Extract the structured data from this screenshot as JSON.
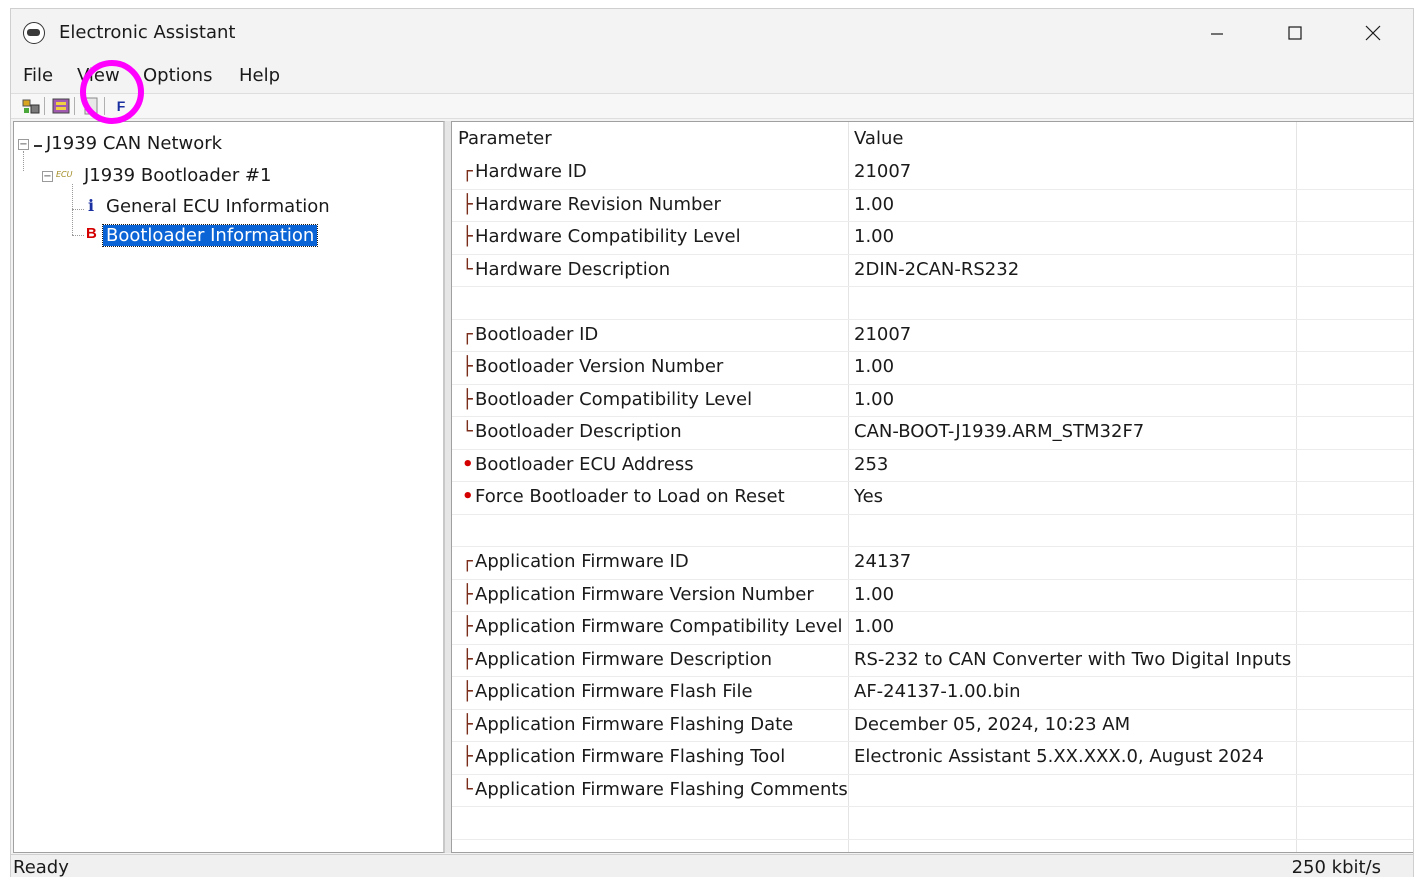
{
  "window": {
    "title": "Electronic Assistant",
    "app_icon": "ea-logo-icon",
    "controls": {
      "minimize": "−",
      "maximize": "☐",
      "close": "✕"
    }
  },
  "menu": [
    "File",
    "View",
    "Options",
    "Help"
  ],
  "toolbar": {
    "buttons": [
      {
        "name": "connect-icon",
        "glyph": "▤"
      },
      {
        "name": "bootloader-icon",
        "glyph": "▦"
      },
      {
        "name": "document-icon",
        "glyph": "▯"
      },
      {
        "name": "flash-icon",
        "glyph": "F"
      }
    ],
    "highlight_color": "#ff00ff"
  },
  "tree": {
    "root": {
      "label": "J1939 CAN Network",
      "expander": "−"
    },
    "ecu": {
      "label": "J1939 Bootloader #1",
      "badge": "ECU",
      "expander": "−"
    },
    "children": [
      {
        "label": "General ECU Information",
        "icon": "i",
        "icon_color": "#1a2fa0"
      },
      {
        "label": "Bootloader Information",
        "icon": "B",
        "icon_color": "#d40000",
        "selected": true
      }
    ],
    "selection_color": "#0a64d6"
  },
  "grid": {
    "headers": {
      "parameter": "Parameter",
      "value": "Value"
    },
    "rows": [
      {
        "marker": "┌",
        "parameter": "Hardware ID",
        "value": "21007"
      },
      {
        "marker": "├",
        "parameter": "Hardware Revision Number",
        "value": "1.00"
      },
      {
        "marker": "├",
        "parameter": "Hardware Compatibility Level",
        "value": "1.00"
      },
      {
        "marker": "└",
        "parameter": "Hardware Description",
        "value": "2DIN-2CAN-RS232"
      },
      {
        "marker": "",
        "parameter": "",
        "value": ""
      },
      {
        "marker": "┌",
        "parameter": "Bootloader ID",
        "value": "21007"
      },
      {
        "marker": "├",
        "parameter": "Bootloader Version Number",
        "value": "1.00"
      },
      {
        "marker": "├",
        "parameter": "Bootloader Compatibility Level",
        "value": "1.00"
      },
      {
        "marker": "└",
        "parameter": "Bootloader Description",
        "value": "CAN-BOOT-J1939.ARM_STM32F7"
      },
      {
        "marker": "•",
        "parameter": "Bootloader ECU Address",
        "value": "253"
      },
      {
        "marker": "•",
        "parameter": "Force Bootloader to Load on Reset",
        "value": "Yes"
      },
      {
        "marker": "",
        "parameter": "",
        "value": ""
      },
      {
        "marker": "┌",
        "parameter": "Application Firmware ID",
        "value": "24137"
      },
      {
        "marker": "├",
        "parameter": "Application Firmware Version Number",
        "value": "1.00"
      },
      {
        "marker": "├",
        "parameter": "Application Firmware Compatibility Level",
        "value": "1.00"
      },
      {
        "marker": "├",
        "parameter": "Application Firmware Description",
        "value": "RS-232 to CAN Converter with Two Digital Inputs"
      },
      {
        "marker": "├",
        "parameter": "Application Firmware Flash File",
        "value": "AF-24137-1.00.bin"
      },
      {
        "marker": "├",
        "parameter": "Application Firmware Flashing Date",
        "value": "December 05, 2024, 10:23 AM"
      },
      {
        "marker": "├",
        "parameter": "Application Firmware Flashing Tool",
        "value": "Electronic Assistant 5.XX.XXX.0, August 2024"
      },
      {
        "marker": "└",
        "parameter": "Application Firmware Flashing Comments",
        "value": ""
      },
      {
        "marker": "",
        "parameter": "",
        "value": ""
      }
    ]
  },
  "status": {
    "left": "Ready",
    "right": "250 kbit/s"
  }
}
